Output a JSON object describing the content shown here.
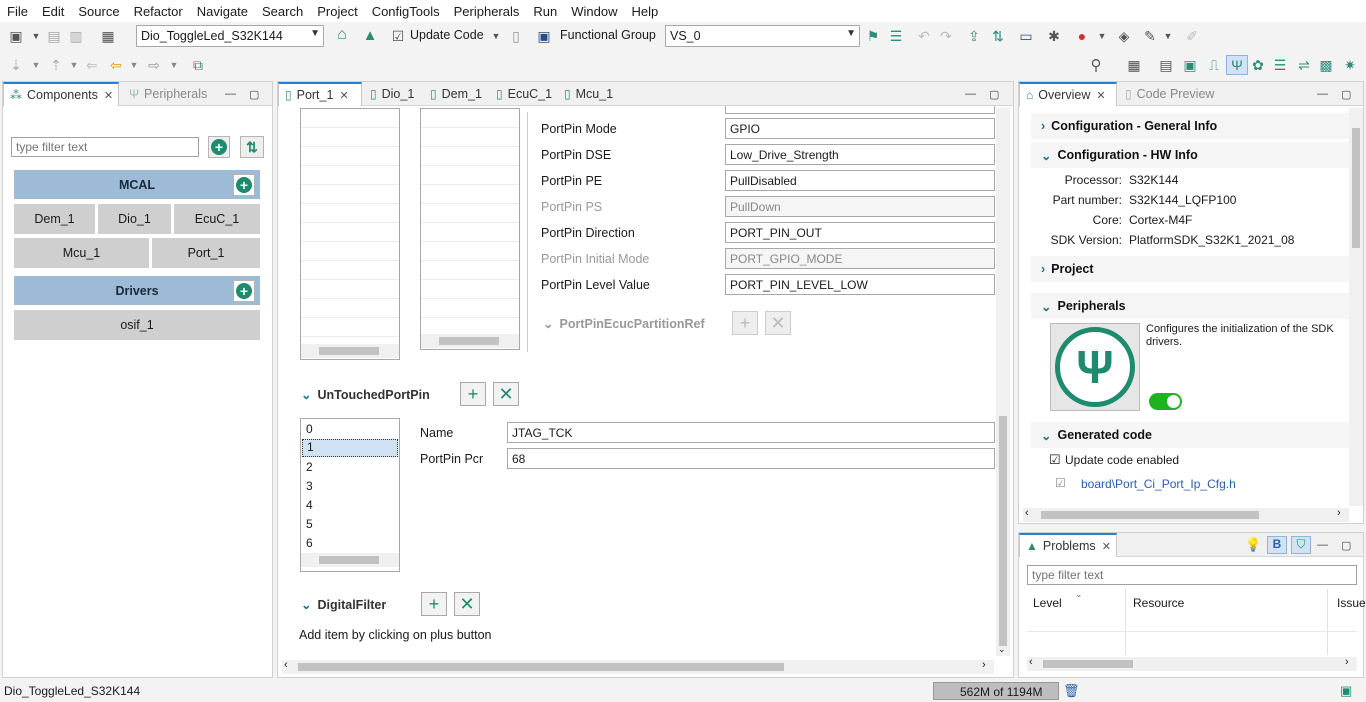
{
  "menu": [
    "File",
    "Edit",
    "Source",
    "Refactor",
    "Navigate",
    "Search",
    "Project",
    "ConfigTools",
    "Peripherals",
    "Run",
    "Window",
    "Help"
  ],
  "toolbar": {
    "project_combo": "Dio_ToggleLed_S32K144",
    "update_code_label": "Update Code",
    "functional_group_label": "Functional Group",
    "functional_group_combo": "VS_0"
  },
  "components_view": {
    "tab_components": "Components",
    "tab_peripherals": "Peripherals",
    "filter_placeholder": "type filter text",
    "categories": [
      {
        "label": "MCAL",
        "items": [
          "Dem_1",
          "Dio_1",
          "EcuC_1",
          "Mcu_1",
          "Port_1"
        ]
      },
      {
        "label": "Drivers",
        "items": [
          "osif_1"
        ]
      }
    ]
  },
  "editor": {
    "tabs": [
      "Port_1",
      "Dio_1",
      "Dem_1",
      "EcuC_1",
      "Mcu_1"
    ],
    "portpin_fields": [
      {
        "label": "PortPin Mode",
        "value": "GPIO",
        "enabled": true
      },
      {
        "label": "PortPin DSE",
        "value": "Low_Drive_Strength",
        "enabled": true
      },
      {
        "label": "PortPin PE",
        "value": "PullDisabled",
        "enabled": true
      },
      {
        "label": "PortPin PS",
        "value": "PullDown",
        "enabled": false
      },
      {
        "label": "PortPin Direction",
        "value": "PORT_PIN_OUT",
        "enabled": true
      },
      {
        "label": "PortPin Initial Mode",
        "value": "PORT_GPIO_MODE",
        "enabled": false
      },
      {
        "label": "PortPin Level Value",
        "value": "PORT_PIN_LEVEL_LOW",
        "enabled": true
      }
    ],
    "ecuc_partition_label": "PortPinEcucPartitionRef",
    "untouched_title": "UnTouchedPortPin",
    "untouched_items": [
      "0",
      "1",
      "2",
      "3",
      "4",
      "5",
      "6"
    ],
    "untouched_selected": 1,
    "name_label": "Name",
    "name_value": "JTAG_TCK",
    "pcr_label": "PortPin Pcr",
    "pcr_value": "68",
    "digital_filter_title": "DigitalFilter",
    "add_item_hint": "Add item by clicking on plus button"
  },
  "overview": {
    "tab_overview": "Overview",
    "tab_code_preview": "Code Preview",
    "general_info": "Configuration - General Info",
    "hw_info": "Configuration - HW Info",
    "hw": [
      {
        "key": "Processor:",
        "value": "S32K144"
      },
      {
        "key": "Part number:",
        "value": "S32K144_LQFP100"
      },
      {
        "key": "Core:",
        "value": "Cortex-M4F"
      },
      {
        "key": "SDK Version:",
        "value": "PlatformSDK_S32K1_2021_08"
      }
    ],
    "project": "Project",
    "peripherals": "Peripherals",
    "peripherals_desc": "Configures the initialization of the SDK drivers.",
    "generated_code": "Generated code",
    "update_code_enabled": "Update code enabled",
    "generated_file": "board\\Port_Ci_Port_Ip_Cfg.h"
  },
  "problems": {
    "tab": "Problems",
    "filter_placeholder": "type filter text",
    "col_level": "Level",
    "col_resource": "Resource",
    "col_issue": "Issue"
  },
  "status": {
    "project": "Dio_ToggleLed_S32K144",
    "memory": "562M of 1194M"
  }
}
